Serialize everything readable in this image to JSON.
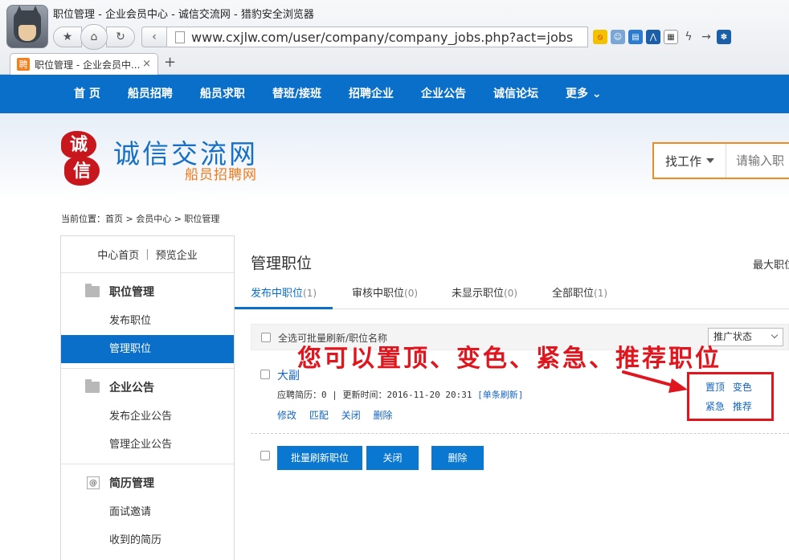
{
  "browser": {
    "window_title": "职位管理 - 企业会员中心 - 诚信交流网 - 猎豹安全浏览器",
    "url": "www.cxjlw.com/user/company/company_jobs.php?act=jobs",
    "tab_title": "职位管理 - 企业会员中...",
    "tab_favicon_text": "聘",
    "tab_close": "×",
    "new_tab": "+"
  },
  "site_nav": {
    "items": [
      "首 页",
      "船员招聘",
      "船员求职",
      "替班/接班",
      "招聘企业",
      "企业公告",
      "诚信论坛",
      "更多 ⌄"
    ]
  },
  "header": {
    "seal_top": "诚",
    "seal_bottom": "信",
    "site_name": "诚信交流网",
    "site_sub": "船员招聘网",
    "search_type": "找工作",
    "search_placeholder": "请输入职"
  },
  "breadcrumb": "当前位置：首页 > 会员中心 > 职位管理",
  "sidebar": {
    "top_links": [
      "中心首页",
      "预览企业"
    ],
    "top_sep": "|",
    "groups": [
      {
        "title": "职位管理",
        "items": [
          "发布职位",
          "管理职位"
        ]
      },
      {
        "title": "企业公告",
        "items": [
          "发布企业公告",
          "管理企业公告"
        ]
      },
      {
        "title": "简历管理",
        "items": [
          "面试邀请",
          "收到的简历"
        ]
      }
    ]
  },
  "main": {
    "title": "管理职位",
    "max_jobs": "最大职位",
    "tabs": [
      {
        "label": "发布中职位",
        "count": "(1)"
      },
      {
        "label": "审核中职位",
        "count": "(0)"
      },
      {
        "label": "未显示职位",
        "count": "(0)"
      },
      {
        "label": "全部职位",
        "count": "(1)"
      }
    ],
    "list_header": {
      "select_all": "全选可批量刷新/职位名称",
      "promo_status": "推广状态"
    },
    "job": {
      "name": "大副",
      "meta": "应聘简历：0 | 更新时间：2016-11-20 20:31",
      "refresh": "[单条刷新]",
      "actions": [
        "修改",
        "匹配",
        "关闭",
        "删除"
      ],
      "tools_row1": [
        "置顶",
        "变色"
      ],
      "tools_row2": [
        "紧急",
        "推荐"
      ]
    },
    "bottom_buttons": [
      "批量刷新职位",
      "关闭",
      "删除"
    ]
  },
  "annotation": {
    "text": "您可以置顶、变色、紧急、推荐职位",
    "color": "#e0161e"
  }
}
